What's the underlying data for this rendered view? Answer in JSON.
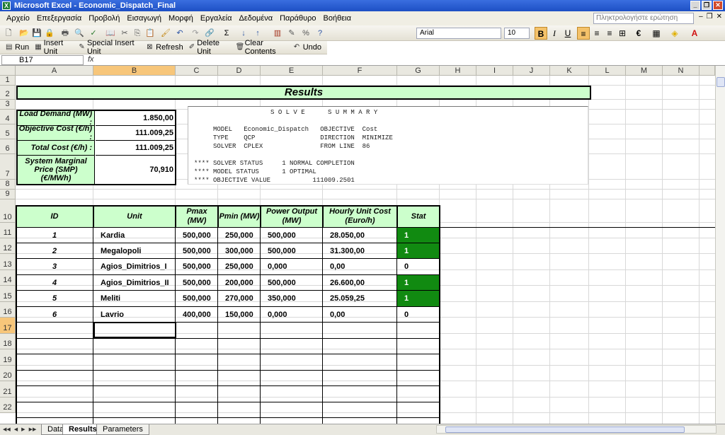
{
  "window": {
    "title": "Microsoft Excel - Economic_Dispatch_Final",
    "app_icon": "X"
  },
  "menu": [
    "Αρχείο",
    "Επεξεργασία",
    "Προβολή",
    "Εισαγωγή",
    "Μορφή",
    "Εργαλεία",
    "Δεδομένα",
    "Παράθυρο",
    "Βοήθεια"
  ],
  "help_placeholder": "Πληκτρολογήστε ερώτηση",
  "font": {
    "name": "Arial",
    "size": "10"
  },
  "custom_toolbar": [
    {
      "label": "Run",
      "icon": "run-icon"
    },
    {
      "label": "Insert Unit",
      "icon": "insert-unit-icon"
    },
    {
      "label": "Special Insert Unit",
      "icon": "special-insert-icon"
    },
    {
      "label": "Refresh",
      "icon": "refresh-icon"
    },
    {
      "label": "Delete Unit",
      "icon": "delete-unit-icon"
    },
    {
      "label": "Clear Contents",
      "icon": "clear-contents-icon"
    },
    {
      "label": "Undo",
      "icon": "undo-icon"
    }
  ],
  "name_box": "B17",
  "fx_label": "fx",
  "columns": [
    "A",
    "B",
    "C",
    "D",
    "E",
    "F",
    "G",
    "H",
    "I",
    "J",
    "K",
    "L",
    "M",
    "N"
  ],
  "rows": [
    "1",
    "2",
    "3",
    "4",
    "5",
    "6",
    "7",
    "8",
    "9",
    "10",
    "11",
    "12",
    "13",
    "14",
    "15",
    "16",
    "17",
    "18",
    "19",
    "20",
    "21",
    "22"
  ],
  "results_title": "Results",
  "summary_lines": {
    "kv": [
      {
        "label": "Load Demand (MW) :",
        "value": "1.850,00"
      },
      {
        "label": "Objective Cost (€/h) :",
        "value": "111.009,25"
      },
      {
        "label": "Total Cost (€/h) :",
        "value": "111.009,25"
      },
      {
        "label": "System Marginal Price (SMP) (€/MWh)",
        "value": "70,910"
      }
    ]
  },
  "solve_summary": [
    "                    S O L V E      S U M M A R Y",
    "",
    "     MODEL   Economic_Dispatch   OBJECTIVE  Cost",
    "     TYPE    QCP                 DIRECTION  MINIMIZE",
    "     SOLVER  CPLEX               FROM LINE  86",
    "",
    "**** SOLVER STATUS     1 NORMAL COMPLETION",
    "**** MODEL STATUS      1 OPTIMAL",
    "**** OBJECTIVE VALUE           111009.2501"
  ],
  "table_headers": [
    "ID",
    "Unit",
    "Pmax (MW)",
    "Pmin (MW)",
    "Power Output (MW)",
    "Hourly Unit Cost (Euro/h)",
    "Stat"
  ],
  "table_rows": [
    {
      "id": "1",
      "unit": "Kardia",
      "pmax": "500,000",
      "pmin": "250,000",
      "output": "500,000",
      "cost": "28.050,00",
      "stat": "1",
      "on": true
    },
    {
      "id": "2",
      "unit": "Megalopoli",
      "pmax": "500,000",
      "pmin": "300,000",
      "output": "500,000",
      "cost": "31.300,00",
      "stat": "1",
      "on": true
    },
    {
      "id": "3",
      "unit": "Agios_Dimitrios_I",
      "pmax": "500,000",
      "pmin": "250,000",
      "output": "0,000",
      "cost": "0,00",
      "stat": "0",
      "on": false
    },
    {
      "id": "4",
      "unit": "Agios_Dimitrios_II",
      "pmax": "500,000",
      "pmin": "200,000",
      "output": "500,000",
      "cost": "26.600,00",
      "stat": "1",
      "on": true
    },
    {
      "id": "5",
      "unit": "Meliti",
      "pmax": "500,000",
      "pmin": "270,000",
      "output": "350,000",
      "cost": "25.059,25",
      "stat": "1",
      "on": true
    },
    {
      "id": "6",
      "unit": "Lavrio",
      "pmax": "400,000",
      "pmin": "150,000",
      "output": "0,000",
      "cost": "0,00",
      "stat": "0",
      "on": false
    }
  ],
  "sheets": [
    {
      "name": "Data",
      "active": false
    },
    {
      "name": "Results",
      "active": true
    },
    {
      "name": "Parameters",
      "active": false
    }
  ],
  "colors": {
    "header_green": "#ccffcc",
    "status_on": "#118a11",
    "selection": "#f7c67a"
  }
}
